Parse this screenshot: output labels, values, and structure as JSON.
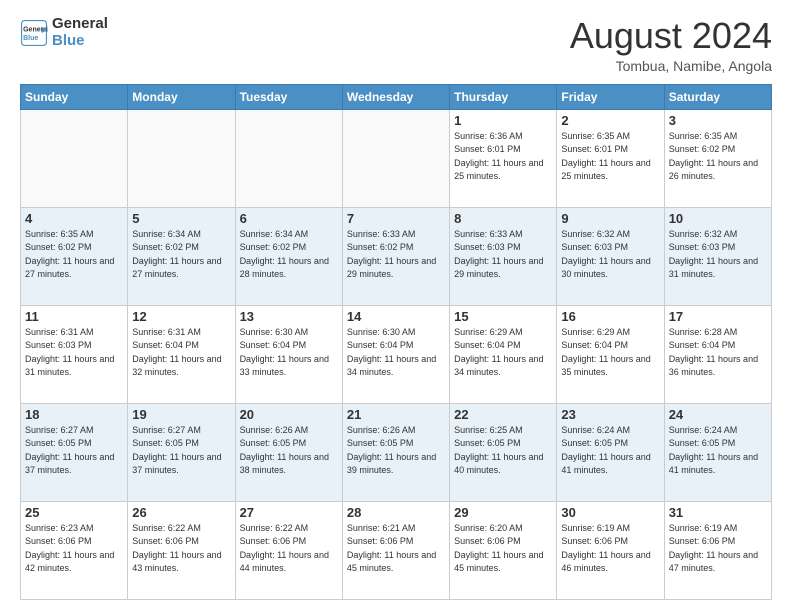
{
  "logo": {
    "text_general": "General",
    "text_blue": "Blue"
  },
  "title": "August 2024",
  "location": "Tombua, Namibe, Angola",
  "days_of_week": [
    "Sunday",
    "Monday",
    "Tuesday",
    "Wednesday",
    "Thursday",
    "Friday",
    "Saturday"
  ],
  "weeks": [
    [
      {
        "day": "",
        "sunrise": "",
        "sunset": "",
        "daylight": "",
        "empty": true
      },
      {
        "day": "",
        "sunrise": "",
        "sunset": "",
        "daylight": "",
        "empty": true
      },
      {
        "day": "",
        "sunrise": "",
        "sunset": "",
        "daylight": "",
        "empty": true
      },
      {
        "day": "",
        "sunrise": "",
        "sunset": "",
        "daylight": "",
        "empty": true
      },
      {
        "day": "1",
        "sunrise": "Sunrise: 6:36 AM",
        "sunset": "Sunset: 6:01 PM",
        "daylight": "Daylight: 11 hours and 25 minutes.",
        "empty": false
      },
      {
        "day": "2",
        "sunrise": "Sunrise: 6:35 AM",
        "sunset": "Sunset: 6:01 PM",
        "daylight": "Daylight: 11 hours and 25 minutes.",
        "empty": false
      },
      {
        "day": "3",
        "sunrise": "Sunrise: 6:35 AM",
        "sunset": "Sunset: 6:02 PM",
        "daylight": "Daylight: 11 hours and 26 minutes.",
        "empty": false
      }
    ],
    [
      {
        "day": "4",
        "sunrise": "Sunrise: 6:35 AM",
        "sunset": "Sunset: 6:02 PM",
        "daylight": "Daylight: 11 hours and 27 minutes.",
        "empty": false
      },
      {
        "day": "5",
        "sunrise": "Sunrise: 6:34 AM",
        "sunset": "Sunset: 6:02 PM",
        "daylight": "Daylight: 11 hours and 27 minutes.",
        "empty": false
      },
      {
        "day": "6",
        "sunrise": "Sunrise: 6:34 AM",
        "sunset": "Sunset: 6:02 PM",
        "daylight": "Daylight: 11 hours and 28 minutes.",
        "empty": false
      },
      {
        "day": "7",
        "sunrise": "Sunrise: 6:33 AM",
        "sunset": "Sunset: 6:02 PM",
        "daylight": "Daylight: 11 hours and 29 minutes.",
        "empty": false
      },
      {
        "day": "8",
        "sunrise": "Sunrise: 6:33 AM",
        "sunset": "Sunset: 6:03 PM",
        "daylight": "Daylight: 11 hours and 29 minutes.",
        "empty": false
      },
      {
        "day": "9",
        "sunrise": "Sunrise: 6:32 AM",
        "sunset": "Sunset: 6:03 PM",
        "daylight": "Daylight: 11 hours and 30 minutes.",
        "empty": false
      },
      {
        "day": "10",
        "sunrise": "Sunrise: 6:32 AM",
        "sunset": "Sunset: 6:03 PM",
        "daylight": "Daylight: 11 hours and 31 minutes.",
        "empty": false
      }
    ],
    [
      {
        "day": "11",
        "sunrise": "Sunrise: 6:31 AM",
        "sunset": "Sunset: 6:03 PM",
        "daylight": "Daylight: 11 hours and 31 minutes.",
        "empty": false
      },
      {
        "day": "12",
        "sunrise": "Sunrise: 6:31 AM",
        "sunset": "Sunset: 6:04 PM",
        "daylight": "Daylight: 11 hours and 32 minutes.",
        "empty": false
      },
      {
        "day": "13",
        "sunrise": "Sunrise: 6:30 AM",
        "sunset": "Sunset: 6:04 PM",
        "daylight": "Daylight: 11 hours and 33 minutes.",
        "empty": false
      },
      {
        "day": "14",
        "sunrise": "Sunrise: 6:30 AM",
        "sunset": "Sunset: 6:04 PM",
        "daylight": "Daylight: 11 hours and 34 minutes.",
        "empty": false
      },
      {
        "day": "15",
        "sunrise": "Sunrise: 6:29 AM",
        "sunset": "Sunset: 6:04 PM",
        "daylight": "Daylight: 11 hours and 34 minutes.",
        "empty": false
      },
      {
        "day": "16",
        "sunrise": "Sunrise: 6:29 AM",
        "sunset": "Sunset: 6:04 PM",
        "daylight": "Daylight: 11 hours and 35 minutes.",
        "empty": false
      },
      {
        "day": "17",
        "sunrise": "Sunrise: 6:28 AM",
        "sunset": "Sunset: 6:04 PM",
        "daylight": "Daylight: 11 hours and 36 minutes.",
        "empty": false
      }
    ],
    [
      {
        "day": "18",
        "sunrise": "Sunrise: 6:27 AM",
        "sunset": "Sunset: 6:05 PM",
        "daylight": "Daylight: 11 hours and 37 minutes.",
        "empty": false
      },
      {
        "day": "19",
        "sunrise": "Sunrise: 6:27 AM",
        "sunset": "Sunset: 6:05 PM",
        "daylight": "Daylight: 11 hours and 37 minutes.",
        "empty": false
      },
      {
        "day": "20",
        "sunrise": "Sunrise: 6:26 AM",
        "sunset": "Sunset: 6:05 PM",
        "daylight": "Daylight: 11 hours and 38 minutes.",
        "empty": false
      },
      {
        "day": "21",
        "sunrise": "Sunrise: 6:26 AM",
        "sunset": "Sunset: 6:05 PM",
        "daylight": "Daylight: 11 hours and 39 minutes.",
        "empty": false
      },
      {
        "day": "22",
        "sunrise": "Sunrise: 6:25 AM",
        "sunset": "Sunset: 6:05 PM",
        "daylight": "Daylight: 11 hours and 40 minutes.",
        "empty": false
      },
      {
        "day": "23",
        "sunrise": "Sunrise: 6:24 AM",
        "sunset": "Sunset: 6:05 PM",
        "daylight": "Daylight: 11 hours and 41 minutes.",
        "empty": false
      },
      {
        "day": "24",
        "sunrise": "Sunrise: 6:24 AM",
        "sunset": "Sunset: 6:05 PM",
        "daylight": "Daylight: 11 hours and 41 minutes.",
        "empty": false
      }
    ],
    [
      {
        "day": "25",
        "sunrise": "Sunrise: 6:23 AM",
        "sunset": "Sunset: 6:06 PM",
        "daylight": "Daylight: 11 hours and 42 minutes.",
        "empty": false
      },
      {
        "day": "26",
        "sunrise": "Sunrise: 6:22 AM",
        "sunset": "Sunset: 6:06 PM",
        "daylight": "Daylight: 11 hours and 43 minutes.",
        "empty": false
      },
      {
        "day": "27",
        "sunrise": "Sunrise: 6:22 AM",
        "sunset": "Sunset: 6:06 PM",
        "daylight": "Daylight: 11 hours and 44 minutes.",
        "empty": false
      },
      {
        "day": "28",
        "sunrise": "Sunrise: 6:21 AM",
        "sunset": "Sunset: 6:06 PM",
        "daylight": "Daylight: 11 hours and 45 minutes.",
        "empty": false
      },
      {
        "day": "29",
        "sunrise": "Sunrise: 6:20 AM",
        "sunset": "Sunset: 6:06 PM",
        "daylight": "Daylight: 11 hours and 45 minutes.",
        "empty": false
      },
      {
        "day": "30",
        "sunrise": "Sunrise: 6:19 AM",
        "sunset": "Sunset: 6:06 PM",
        "daylight": "Daylight: 11 hours and 46 minutes.",
        "empty": false
      },
      {
        "day": "31",
        "sunrise": "Sunrise: 6:19 AM",
        "sunset": "Sunset: 6:06 PM",
        "daylight": "Daylight: 11 hours and 47 minutes.",
        "empty": false
      }
    ]
  ]
}
